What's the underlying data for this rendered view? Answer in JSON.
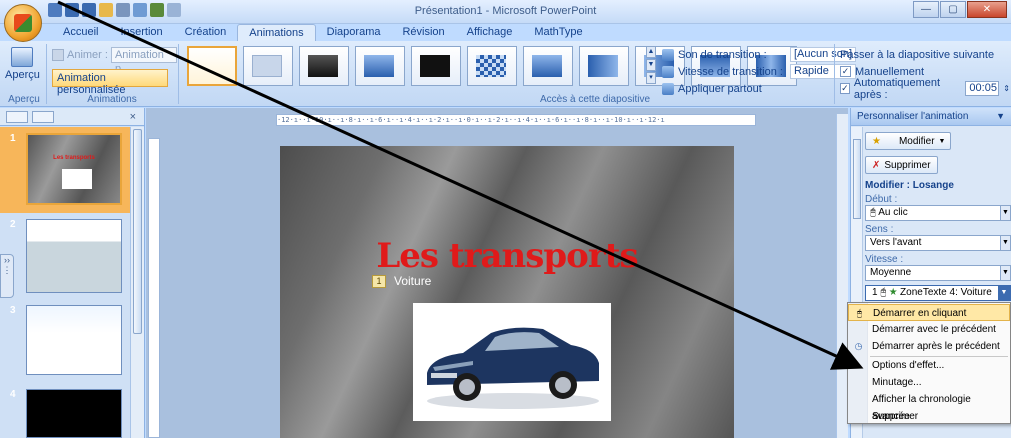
{
  "window": {
    "title": "Présentation1 - Microsoft PowerPoint",
    "minimize_glyph": "—",
    "maximize_glyph": "▢",
    "close_glyph": "✕"
  },
  "colors": {
    "accent": "#15428b",
    "highlight": "#ffd97a",
    "title_red": "#e01a1a"
  },
  "tabs": [
    "Accueil",
    "Insertion",
    "Création",
    "Animations",
    "Diaporama",
    "Révision",
    "Affichage",
    "MathType"
  ],
  "active_tab": "Animations",
  "ribbon": {
    "apercu_label": "Aperçu",
    "apercu_group": "Aperçu",
    "animer_label": "Animer :",
    "animer_value": "Animation p...",
    "custom_anim_label": "Animation personnalisée",
    "animations_group": "Animations",
    "transition_group": "Accès à cette diapositive",
    "son_label": "Son de transition :",
    "son_value": "[Aucun son]",
    "vitesse_label": "Vitesse de transition :",
    "vitesse_value": "Rapide",
    "appliquer_label": "Appliquer partout",
    "next_slide_header": "Passer à la diapositive suivante",
    "manual_label": "Manuellement",
    "auto_label": "Automatiquement après :",
    "auto_value": "00:05"
  },
  "slides_panel": {
    "slides": [
      {
        "num": "1",
        "title_text": "Les transports"
      },
      {
        "num": "2"
      },
      {
        "num": "3"
      },
      {
        "num": "4"
      }
    ],
    "close_glyph": "×"
  },
  "editor": {
    "ruler_text": "·12·ı··ı·10·ı··ı·8·ı··ı·6·ı··ı·4·ı··ı·2·ı··ı·0·ı··ı·2·ı··ı·4·ı··ı·6·ı··ı·8·ı··ı·10·ı··ı·12·ı",
    "slide_title": "Les transports",
    "anim_tag": "1",
    "bullet_text": "Voiture"
  },
  "pane": {
    "header": "Personnaliser l'animation",
    "modifier_button": "Modifier",
    "supprimer_button": "Supprimer",
    "section_title": "Modifier : Losange",
    "debut_label": "Début :",
    "debut_value": "Au clic",
    "sens_label": "Sens :",
    "sens_value": "Vers l'avant",
    "vitesse_label": "Vitesse :",
    "vitesse_value": "Moyenne",
    "list_item_index": "1",
    "list_item_text": "ZoneTexte 4: Voiture"
  },
  "context_menu": {
    "items": [
      "Démarrer en cliquant",
      "Démarrer avec le précédent",
      "Démarrer après le précédent",
      "Options d'effet...",
      "Minutage...",
      "Afficher la chronologie avancée",
      "Supprimer"
    ]
  }
}
